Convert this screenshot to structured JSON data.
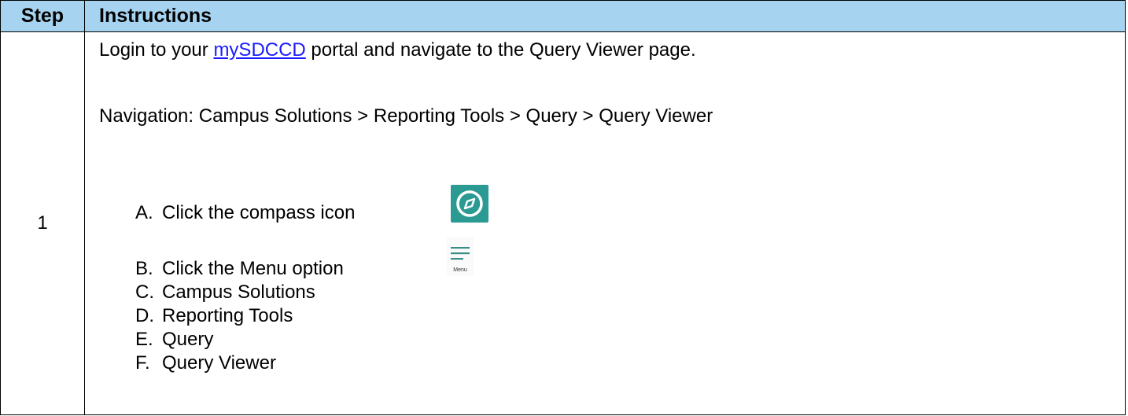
{
  "table": {
    "headers": {
      "step": "Step",
      "instructions": "Instructions"
    },
    "row": {
      "step_number": "1",
      "intro": {
        "before_link": "Login to your ",
        "link_text": "mySDCCD",
        "after_link": " portal and navigate to the Query Viewer page."
      },
      "navigation": "Navigation: Campus Solutions > Reporting Tools > Query > Query Viewer",
      "steps": [
        {
          "letter": "A.",
          "text": "Click the compass icon",
          "icon": "compass-icon"
        },
        {
          "letter": "B.",
          "text": "Click the Menu option",
          "icon": "menu-icon",
          "icon_label": "Menu"
        },
        {
          "letter": "C.",
          "text": "Campus Solutions"
        },
        {
          "letter": "D.",
          "text": "Reporting Tools"
        },
        {
          "letter": "E.",
          "text": "Query"
        },
        {
          "letter": "F.",
          "text": "Query Viewer"
        }
      ]
    }
  },
  "colors": {
    "header_background": "#a6d3ef",
    "link": "#1a1aff",
    "compass_icon_background": "#2a9a93",
    "menu_icon_lines": "#3a8e87"
  }
}
